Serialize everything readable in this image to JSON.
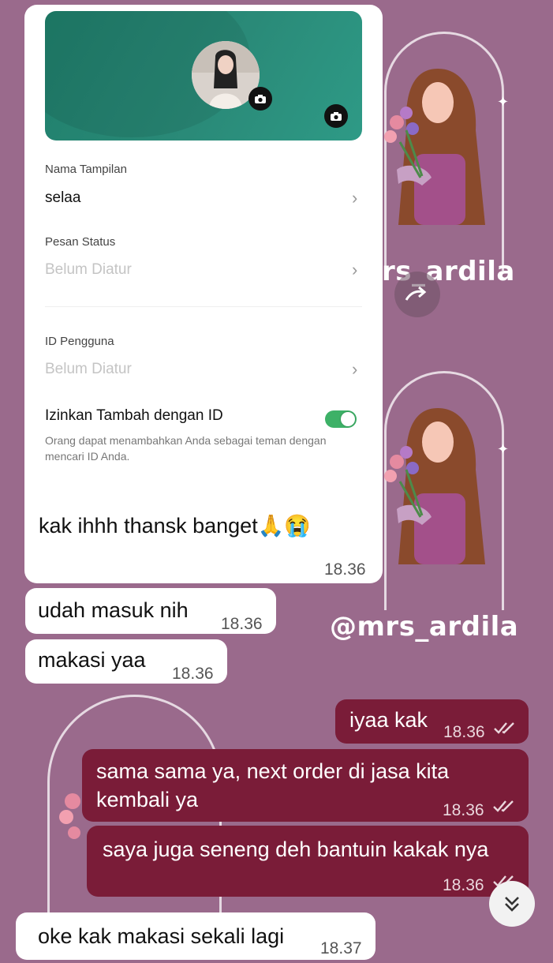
{
  "watermark": {
    "handle": "@mrs_ardila",
    "handle_partial_top": "rs_ardila"
  },
  "profile_card": {
    "display_name_label": "Nama Tampilan",
    "display_name_value": "selaa",
    "status_label": "Pesan Status",
    "status_value": "Belum Diatur",
    "user_id_label": "ID Pengguna",
    "user_id_value": "Belum Diatur",
    "allow_add_label": "Izinkan Tambah dengan ID",
    "allow_add_desc": "Orang dapat menambahkan Anda sebagai teman dengan mencari ID Anda.",
    "allow_add_enabled": true,
    "caption": "kak ihhh thansk banget",
    "caption_emoji": "🙏😭",
    "time": "18.36"
  },
  "messages": [
    {
      "direction": "in",
      "text": "udah masuk nih",
      "time": "18.36"
    },
    {
      "direction": "in",
      "text": "makasi yaa",
      "time": "18.36"
    },
    {
      "direction": "out",
      "text": "iyaa kak",
      "time": "18.36"
    },
    {
      "direction": "out",
      "text_line1": "sama sama ya, next order di jasa kita",
      "text_line2": "kembali ya",
      "time": "18.36"
    },
    {
      "direction": "out",
      "text": "saya juga seneng deh bantuin kakak nya",
      "time": "18.36"
    },
    {
      "direction": "in",
      "text": "oke kak makasi sekali lagi",
      "time": "18.37"
    }
  ],
  "colors": {
    "background": "#9a6a8c",
    "incoming_bubble": "#ffffff",
    "outgoing_bubble": "#7a1c38",
    "banner": "#2a8a78",
    "toggle_on": "#3db167"
  },
  "icons": [
    "camera-icon",
    "chevron-right-icon",
    "double-check-icon",
    "scroll-down-icon",
    "forward-icon"
  ]
}
